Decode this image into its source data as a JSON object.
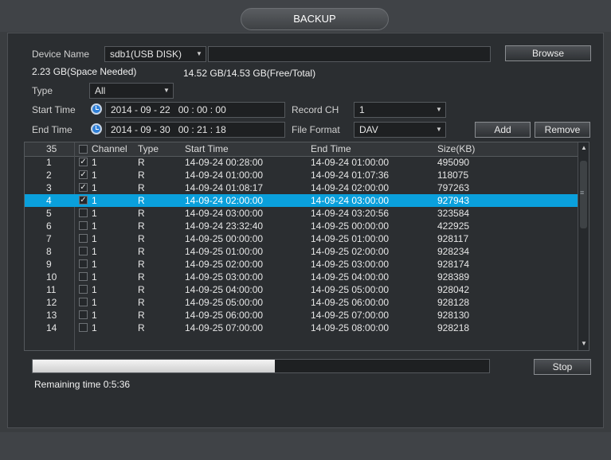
{
  "window": {
    "title": "BACKUP"
  },
  "device": {
    "label": "Device Name",
    "value": "sdb1(USB DISK)",
    "browse_label": "Browse",
    "space_needed": "2.23 GB(Space Needed)",
    "free_total": "14.52 GB/14.53 GB(Free/Total)"
  },
  "type": {
    "label": "Type",
    "value": "All"
  },
  "start_time": {
    "label": "Start Time",
    "value": "2014 - 09 - 22   00 : 00 : 00"
  },
  "end_time": {
    "label": "End Time",
    "value": "2014 - 09 - 30   00 : 21 : 18"
  },
  "record_ch": {
    "label": "Record CH",
    "value": "1"
  },
  "file_format": {
    "label": "File Format",
    "value": "DAV"
  },
  "buttons": {
    "add": "Add",
    "remove": "Remove",
    "stop": "Stop"
  },
  "table": {
    "count": "35",
    "headers": {
      "channel": "Channel",
      "type": "Type",
      "start": "Start Time",
      "end": "End Time",
      "size": "Size(KB)"
    },
    "rows": [
      {
        "no": "1",
        "checked": true,
        "channel": "1",
        "type": "R",
        "start": "14-09-24 00:28:00",
        "end": "14-09-24 01:00:00",
        "size": "495090"
      },
      {
        "no": "2",
        "checked": true,
        "channel": "1",
        "type": "R",
        "start": "14-09-24 01:00:00",
        "end": "14-09-24 01:07:36",
        "size": "118075"
      },
      {
        "no": "3",
        "checked": true,
        "channel": "1",
        "type": "R",
        "start": "14-09-24 01:08:17",
        "end": "14-09-24 02:00:00",
        "size": "797263"
      },
      {
        "no": "4",
        "checked": true,
        "channel": "1",
        "type": "R",
        "start": "14-09-24 02:00:00",
        "end": "14-09-24 03:00:00",
        "size": "927943",
        "selected": true
      },
      {
        "no": "5",
        "checked": false,
        "channel": "1",
        "type": "R",
        "start": "14-09-24 03:00:00",
        "end": "14-09-24 03:20:56",
        "size": "323584"
      },
      {
        "no": "6",
        "checked": false,
        "channel": "1",
        "type": "R",
        "start": "14-09-24 23:32:40",
        "end": "14-09-25 00:00:00",
        "size": "422925"
      },
      {
        "no": "7",
        "checked": false,
        "channel": "1",
        "type": "R",
        "start": "14-09-25 00:00:00",
        "end": "14-09-25 01:00:00",
        "size": "928117"
      },
      {
        "no": "8",
        "checked": false,
        "channel": "1",
        "type": "R",
        "start": "14-09-25 01:00:00",
        "end": "14-09-25 02:00:00",
        "size": "928234"
      },
      {
        "no": "9",
        "checked": false,
        "channel": "1",
        "type": "R",
        "start": "14-09-25 02:00:00",
        "end": "14-09-25 03:00:00",
        "size": "928174"
      },
      {
        "no": "10",
        "checked": false,
        "channel": "1",
        "type": "R",
        "start": "14-09-25 03:00:00",
        "end": "14-09-25 04:00:00",
        "size": "928389"
      },
      {
        "no": "11",
        "checked": false,
        "channel": "1",
        "type": "R",
        "start": "14-09-25 04:00:00",
        "end": "14-09-25 05:00:00",
        "size": "928042"
      },
      {
        "no": "12",
        "checked": false,
        "channel": "1",
        "type": "R",
        "start": "14-09-25 05:00:00",
        "end": "14-09-25 06:00:00",
        "size": "928128"
      },
      {
        "no": "13",
        "checked": false,
        "channel": "1",
        "type": "R",
        "start": "14-09-25 06:00:00",
        "end": "14-09-25 07:00:00",
        "size": "928130"
      },
      {
        "no": "14",
        "checked": false,
        "channel": "1",
        "type": "R",
        "start": "14-09-25 07:00:00",
        "end": "14-09-25 08:00:00",
        "size": "928218"
      }
    ]
  },
  "progress": {
    "fraction": 0.53
  },
  "remaining": "Remaining time 0:5:36",
  "icons": {
    "clock": "clock-icon",
    "dropdown": "chevron-down-icon",
    "scroll_up": "scroll-up-arrow-icon",
    "scroll_down": "scroll-down-arrow-icon"
  },
  "colors": {
    "selected_row": "#0aa0dc",
    "panel": "#2b2e31"
  }
}
